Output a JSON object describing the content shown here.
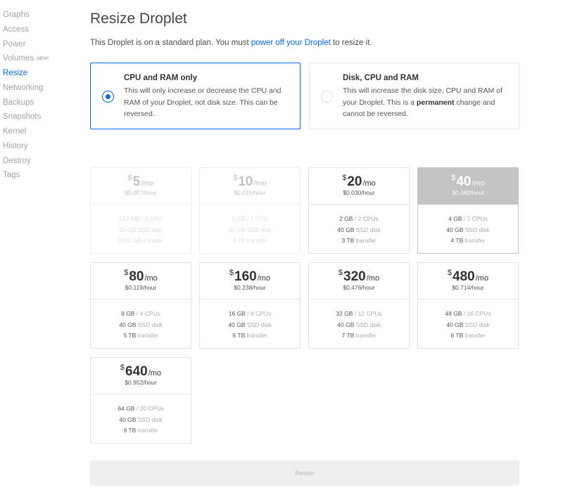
{
  "sidebar": {
    "items": [
      {
        "label": "Graphs"
      },
      {
        "label": "Access"
      },
      {
        "label": "Power"
      },
      {
        "label": "Volumes",
        "badge": "NEW!"
      },
      {
        "label": "Resize",
        "active": true
      },
      {
        "label": "Networking"
      },
      {
        "label": "Backups"
      },
      {
        "label": "Snapshots"
      },
      {
        "label": "Kernel"
      },
      {
        "label": "History"
      },
      {
        "label": "Destroy"
      },
      {
        "label": "Tags"
      }
    ]
  },
  "main": {
    "title": "Resize Droplet",
    "intro": {
      "before": "This Droplet is on a standard plan. You must ",
      "link": "power off your Droplet",
      "after": " to resize it."
    },
    "options": [
      {
        "title": "CPU and RAM only",
        "desc": "This will only increase or decrease the CPU and RAM of your Droplet, not disk size. This can be reversed.",
        "selected": true
      },
      {
        "title": "Disk, CPU and RAM",
        "desc_before": "This will increase the disk size, CPU and RAM of your Droplet. This is a ",
        "desc_bold": "permanent",
        "desc_after": " change and cannot be reversed.",
        "selected": false
      }
    ],
    "plans": [
      {
        "currency": "$",
        "price": "5",
        "per": "/mo",
        "hourly": "$0.007/hour",
        "mem": "512 MB",
        "cpus": "/ 1 CPU",
        "disk": "20 GB",
        "disk_label": "SSD disk",
        "transfer": "1000 GB",
        "transfer_label": "transfer",
        "state": "disabled"
      },
      {
        "currency": "$",
        "price": "10",
        "per": "/mo",
        "hourly": "$0.015/hour",
        "mem": "1 GB",
        "cpus": "/ 1 CPU",
        "disk": "30 GB",
        "disk_label": "SSD disk",
        "transfer": "2 TB",
        "transfer_label": "transfer",
        "state": "disabled"
      },
      {
        "currency": "$",
        "price": "20",
        "per": "/mo",
        "hourly": "$0.030/hour",
        "mem": "2 GB",
        "cpus": "/ 2 CPUs",
        "disk": "40 GB",
        "disk_label": "SSD disk",
        "transfer": "3 TB",
        "transfer_label": "transfer",
        "state": "available"
      },
      {
        "currency": "$",
        "price": "40",
        "per": "/mo",
        "hourly": "$0.060/hour",
        "mem": "4 GB",
        "cpus": "/ 2 CPUs",
        "disk": "40 GB",
        "disk_label": "SSD disk",
        "transfer": "4 TB",
        "transfer_label": "transfer",
        "state": "current"
      },
      {
        "currency": "$",
        "price": "80",
        "per": "/mo",
        "hourly": "$0.119/hour",
        "mem": "8 GB",
        "cpus": "/ 4 CPUs",
        "disk": "40 GB",
        "disk_label": "SSD disk",
        "transfer": "5 TB",
        "transfer_label": "transfer",
        "state": "available"
      },
      {
        "currency": "$",
        "price": "160",
        "per": "/mo",
        "hourly": "$0.238/hour",
        "mem": "16 GB",
        "cpus": "/ 8 CPUs",
        "disk": "40 GB",
        "disk_label": "SSD disk",
        "transfer": "6 TB",
        "transfer_label": "transfer",
        "state": "available"
      },
      {
        "currency": "$",
        "price": "320",
        "per": "/mo",
        "hourly": "$0.476/hour",
        "mem": "32 GB",
        "cpus": "/ 12 CPUs",
        "disk": "40 GB",
        "disk_label": "SSD disk",
        "transfer": "7 TB",
        "transfer_label": "transfer",
        "state": "available"
      },
      {
        "currency": "$",
        "price": "480",
        "per": "/mo",
        "hourly": "$0.714/hour",
        "mem": "48 GB",
        "cpus": "/ 16 CPUs",
        "disk": "40 GB",
        "disk_label": "SSD disk",
        "transfer": "8 TB",
        "transfer_label": "transfer",
        "state": "available"
      },
      {
        "currency": "$",
        "price": "640",
        "per": "/mo",
        "hourly": "$0.952/hour",
        "mem": "64 GB",
        "cpus": "/ 20 CPUs",
        "disk": "40 GB",
        "disk_label": "SSD disk",
        "transfer": "9 TB",
        "transfer_label": "transfer",
        "state": "available"
      }
    ],
    "resize_button": "Resize"
  },
  "colors": {
    "accent": "#0069ff",
    "current_plan": "#c3c3c3",
    "button_bg": "#efefef"
  }
}
